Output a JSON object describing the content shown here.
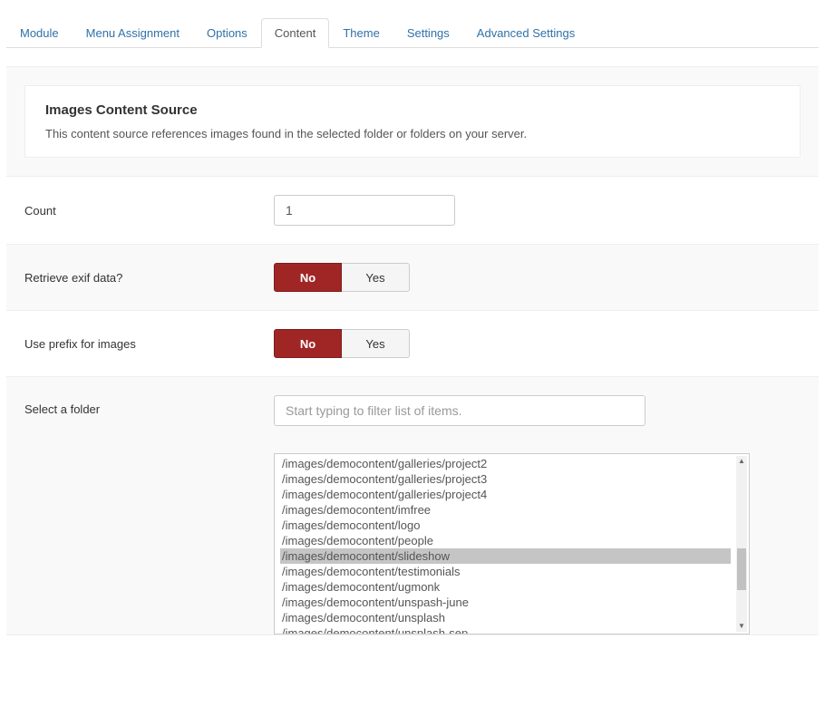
{
  "tabs": [
    {
      "label": "Module",
      "active": false
    },
    {
      "label": "Menu Assignment",
      "active": false
    },
    {
      "label": "Options",
      "active": false
    },
    {
      "label": "Content",
      "active": true
    },
    {
      "label": "Theme",
      "active": false
    },
    {
      "label": "Settings",
      "active": false
    },
    {
      "label": "Advanced Settings",
      "active": false
    }
  ],
  "intro": {
    "title": "Images Content Source",
    "desc": "This content source references images found in the selected folder or folders on your server."
  },
  "fields": {
    "count": {
      "label": "Count",
      "value": "1"
    },
    "exif": {
      "label": "Retrieve exif data?",
      "no": "No",
      "yes": "Yes",
      "value": "No"
    },
    "prefix": {
      "label": "Use prefix for images",
      "no": "No",
      "yes": "Yes",
      "value": "No"
    },
    "folder": {
      "label": "Select a folder",
      "placeholder": "Start typing to filter list of items."
    }
  },
  "folders": [
    {
      "path": "/images/democontent/galleries/project2",
      "selected": false
    },
    {
      "path": "/images/democontent/galleries/project3",
      "selected": false
    },
    {
      "path": "/images/democontent/galleries/project4",
      "selected": false
    },
    {
      "path": "/images/democontent/imfree",
      "selected": false
    },
    {
      "path": "/images/democontent/logo",
      "selected": false
    },
    {
      "path": "/images/democontent/people",
      "selected": false
    },
    {
      "path": "/images/democontent/slideshow",
      "selected": true
    },
    {
      "path": "/images/democontent/testimonials",
      "selected": false
    },
    {
      "path": "/images/democontent/ugmonk",
      "selected": false
    },
    {
      "path": "/images/democontent/unspash-june",
      "selected": false
    },
    {
      "path": "/images/democontent/unsplash",
      "selected": false
    },
    {
      "path": "/images/democontent/unsplash-sep",
      "selected": false
    }
  ]
}
